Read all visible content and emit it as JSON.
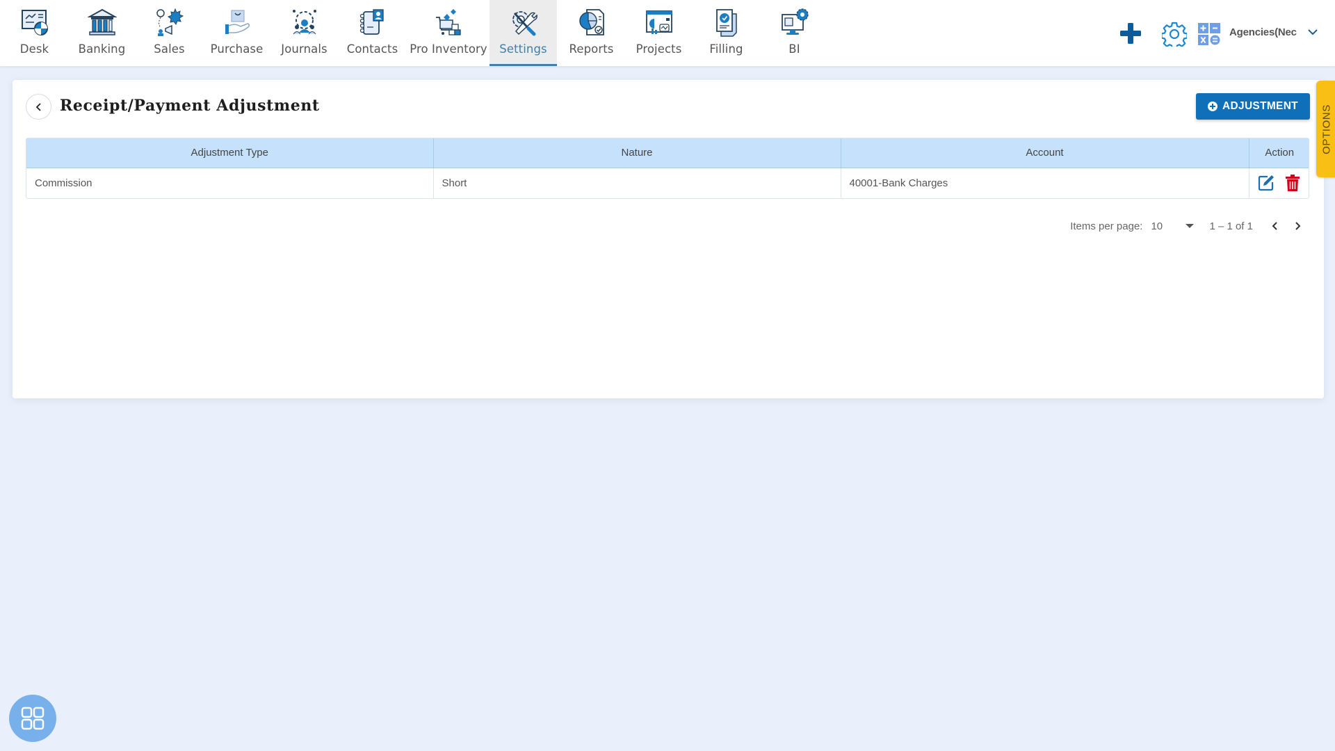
{
  "nav": {
    "items": [
      {
        "label": "Desk",
        "icon": "desk-icon",
        "active": false
      },
      {
        "label": "Banking",
        "icon": "bank-icon",
        "active": false
      },
      {
        "label": "Sales",
        "icon": "sales-icon",
        "active": false
      },
      {
        "label": "Purchase",
        "icon": "purchase-icon",
        "active": false
      },
      {
        "label": "Journals",
        "icon": "journals-icon",
        "active": false
      },
      {
        "label": "Contacts",
        "icon": "contacts-icon",
        "active": false
      },
      {
        "label": "Pro Inventory",
        "icon": "inventory-icon",
        "active": false
      },
      {
        "label": "Settings",
        "icon": "settings-icon",
        "active": true
      },
      {
        "label": "Reports",
        "icon": "reports-icon",
        "active": false
      },
      {
        "label": "Projects",
        "icon": "projects-icon",
        "active": false
      },
      {
        "label": "Filling",
        "icon": "filing-icon",
        "active": false
      },
      {
        "label": "BI",
        "icon": "bi-icon",
        "active": false
      }
    ],
    "company_name": "Agencies(Nec",
    "icons": {
      "add": "plus-icon",
      "settings": "gear-icon",
      "calculator": "calculator-icon",
      "dropdown": "chevron-down-icon"
    }
  },
  "page": {
    "title": "Receipt/Payment Adjustment",
    "add_button_label": "ADJUSTMENT",
    "options_tab_label": "OPTIONS"
  },
  "table": {
    "columns": [
      "Adjustment Type",
      "Nature",
      "Account",
      "Action"
    ],
    "rows": [
      {
        "adjustment_type": "Commission",
        "nature": "Short",
        "account": "40001-Bank Charges",
        "actions": [
          "edit",
          "delete"
        ]
      }
    ]
  },
  "pagination": {
    "items_per_page_label": "Items per page:",
    "items_per_page": "10",
    "range": "1 – 1 of 1"
  },
  "colors": {
    "primary": "#0f6fb8",
    "header_bg": "#c5e1fb",
    "options_tab": "#f9bf14",
    "delete": "#d0021b",
    "active_nav": "#3f7fa8"
  }
}
